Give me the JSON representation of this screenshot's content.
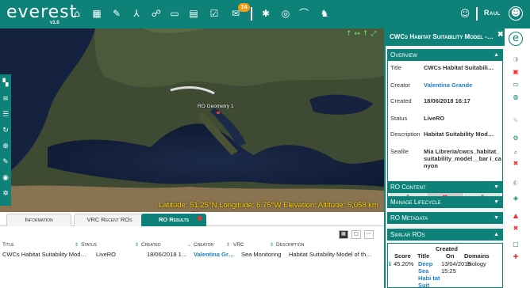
{
  "app": {
    "logo": "everest",
    "version": "v1.0",
    "notifications": "14",
    "user": "Raul"
  },
  "topbar": {
    "icons": [
      "home-icon",
      "dashboard-icon",
      "tools-icon",
      "workflow-icon",
      "community-icon",
      "chat-icon",
      "calendar-icon",
      "checklist-icon",
      "notification-icon",
      "bookmark-icon",
      "target-icon",
      "education-icon",
      "animal-icon"
    ]
  },
  "map": {
    "top_right": "↑ ↔ ↑ ⤢",
    "label": "RO Geometry 1",
    "coordinates": "Latitude: 51.25°N  Longitude: 6.75°W  Elevation:  Altitude: 5,058 km",
    "toolbar_icons": [
      "map-icon",
      "layers-icon",
      "list-icon",
      "history-icon",
      "zoom-icon",
      "draw-icon",
      "globe-icon",
      "settings-icon"
    ]
  },
  "tabs": [
    {
      "label": "Information"
    },
    {
      "label": "VRC Recent ROs"
    },
    {
      "label": "RO Results"
    }
  ],
  "table": {
    "headers": [
      "Title",
      "Status",
      "Created",
      "Creator",
      "VRC",
      "Description"
    ],
    "row": {
      "title": "CWCs Habitat Suitability Mod…",
      "status": "LiveRO",
      "created": "18/06/2018 1…",
      "creator": "Valentina Gr…",
      "vrc": "Sea Monitoring",
      "description": "Habitat Suitability Model of th…"
    }
  },
  "panel": {
    "title": "CWCs Habitat Suitability Model -…",
    "overview_label": "Overview",
    "overview": {
      "title_k": "Title",
      "title_v": "CWCs Habitat Suitabili…",
      "creator_k": "Creator",
      "creator_v": "Valentina Grande",
      "created_k": "Created",
      "created_v": "18/06/2018 16:17",
      "status_k": "Status",
      "status_v": "LiveRO",
      "desc_k": "Description",
      "desc_v": "Habitat Suitability Mod…",
      "seafile_k": "Seafile",
      "seafile_v": "Mia Libreria/cwcs_habitat_suitability_model__bar i_canyon"
    },
    "sections": [
      "RO Content",
      "Manage Lifecycle",
      "RO Metadata",
      "Similar ROs"
    ],
    "similar": {
      "created_head": "Created",
      "headers": [
        "Score",
        "Title",
        "On",
        "Domains"
      ],
      "row": {
        "score": "45.20%",
        "title": "Deep Sea Habi tat Suit",
        "on": "13/04/2018 15:25",
        "domain": "biology"
      }
    }
  },
  "colors": {
    "primary": "#0e8278",
    "link": "#1f7fc1",
    "badge": "#f39c12",
    "coords": "#ffd400"
  }
}
